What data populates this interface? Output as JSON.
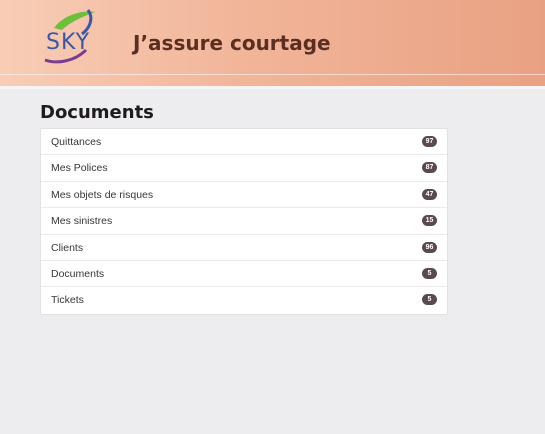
{
  "header": {
    "logo_text": "SKY",
    "brand": "J’assure courtage"
  },
  "main": {
    "title": "Documents",
    "items": [
      {
        "label": "Quittances",
        "count": "97"
      },
      {
        "label": "Mes Polices",
        "count": "87"
      },
      {
        "label": "Mes objets de risques",
        "count": "47"
      },
      {
        "label": "Mes sinistres",
        "count": "15"
      },
      {
        "label": "Clients",
        "count": "96"
      },
      {
        "label": "Documents",
        "count": "5"
      },
      {
        "label": "Tickets",
        "count": "5"
      }
    ]
  },
  "colors": {
    "header_start": "#f8cdb6",
    "header_end": "#e9a183",
    "brand_text": "#5b2e22",
    "badge": "#5a4a50",
    "logo_blue": "#3b57a8",
    "logo_green": "#6cbf3a",
    "logo_purple": "#7a3c8c"
  }
}
